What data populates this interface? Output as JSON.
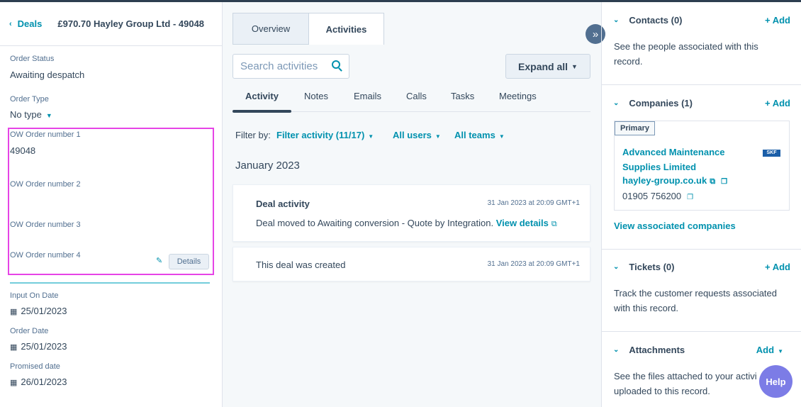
{
  "header": {
    "back_label": "Deals",
    "deal_title": "£970.70 Hayley Group Ltd - 49048"
  },
  "properties": [
    {
      "label": "Order Status",
      "value": "Awaiting despatch"
    },
    {
      "label": "Order Type",
      "value": "No type"
    },
    {
      "label": "OW Order number 1",
      "value": "49048"
    },
    {
      "label": "OW Order number 2",
      "value": ""
    },
    {
      "label": "OW Order number 3",
      "value": ""
    },
    {
      "label": "OW Order number 4",
      "value": ""
    },
    {
      "label": "Input On Date",
      "value": "25/01/2023"
    },
    {
      "label": "Order Date",
      "value": "25/01/2023"
    },
    {
      "label": "Promised date",
      "value": "26/01/2023"
    }
  ],
  "details_button": "Details",
  "tabs": {
    "overview": "Overview",
    "activities": "Activities"
  },
  "search": {
    "placeholder": "Search activities"
  },
  "expand_all": "Expand all",
  "subtabs": [
    "Activity",
    "Notes",
    "Emails",
    "Calls",
    "Tasks",
    "Meetings"
  ],
  "filter": {
    "label": "Filter by:",
    "activity": "Filter activity (11/17)",
    "users": "All users",
    "teams": "All teams"
  },
  "month": "January 2023",
  "activities": [
    {
      "title": "Deal activity",
      "timestamp": "31 Jan 2023 at 20:09 GMT+1",
      "body": "Deal moved to Awaiting conversion - Quote by Integration.",
      "link": "View details"
    },
    {
      "title": "This deal was created",
      "timestamp": "31 Jan 2023 at 20:09 GMT+1"
    }
  ],
  "sidebar": {
    "contacts": {
      "title": "Contacts (0)",
      "add": "+ Add",
      "text": "See the people associated with this record."
    },
    "companies": {
      "title": "Companies (1)",
      "add": "+ Add",
      "primary": "Primary",
      "name": "Advanced Maintenance Supplies Limited",
      "domain": "hayley-group.co.uk",
      "phone": "01905 756200",
      "logo_text": "SKF",
      "view_link": "View associated companies"
    },
    "tickets": {
      "title": "Tickets (0)",
      "add": "+ Add",
      "text": "Track the customer requests associated with this record."
    },
    "attachments": {
      "title": "Attachments",
      "add": "Add",
      "text": "See the files attached to your activi uploaded to this record."
    }
  },
  "help_label": "Help",
  "colors": {
    "accent": "#0091ae",
    "highlight": "#e644e6",
    "help": "#7c7ce6"
  }
}
